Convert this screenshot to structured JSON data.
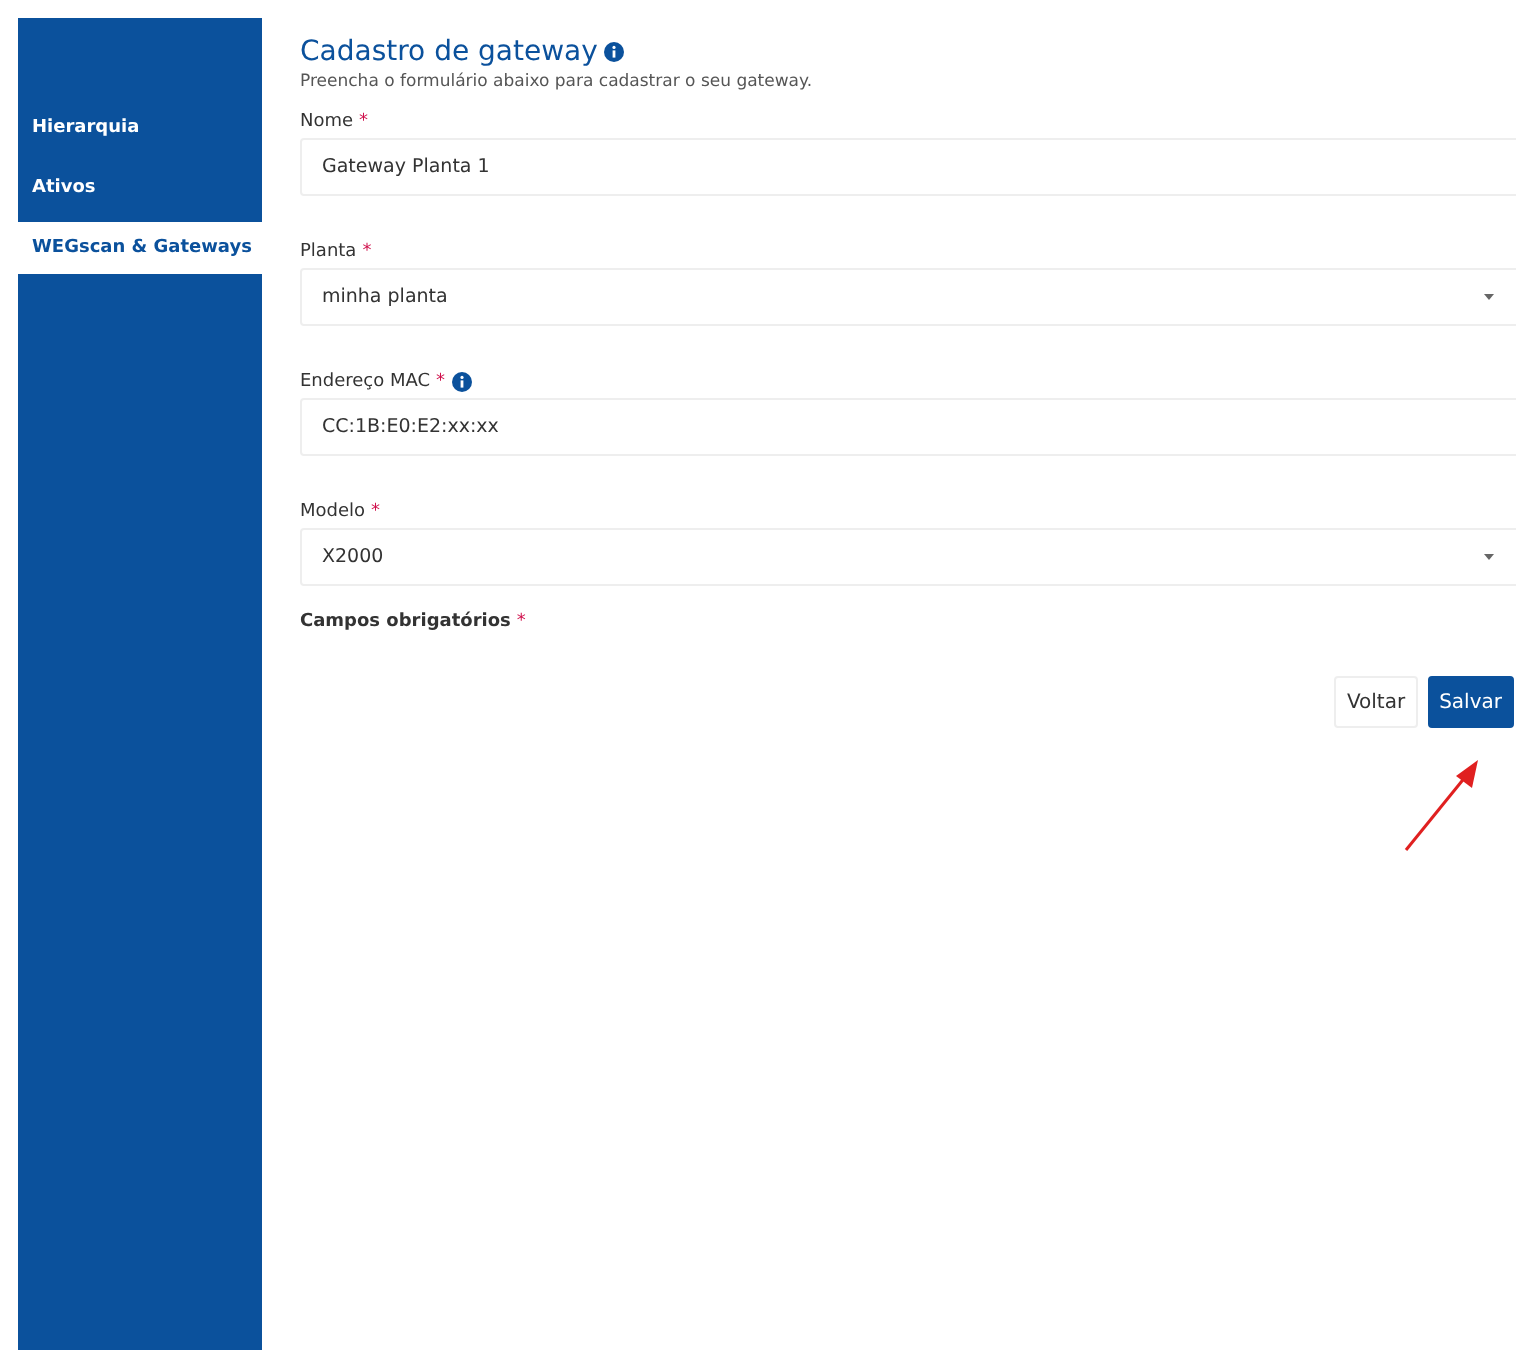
{
  "sidebar": {
    "items": [
      {
        "label": "Hierarquia",
        "selected": false
      },
      {
        "label": "Ativos",
        "selected": false
      },
      {
        "label": "WEGscan & Gateways",
        "selected": true
      }
    ]
  },
  "form": {
    "title": "Cadastro de gateway",
    "subtitle": "Preencha o formulário abaixo para cadastrar o seu gateway.",
    "fields": [
      {
        "label": "Nome",
        "kind": "text",
        "value": "Gateway Planta 1",
        "info": false
      },
      {
        "label": "Planta",
        "kind": "select",
        "value": "minha planta",
        "info": false
      },
      {
        "label": "Endereço MAC",
        "kind": "text",
        "value": "CC:1B:E0:E2:xx:xx",
        "info": true
      },
      {
        "label": "Modelo",
        "kind": "select",
        "value": "X2000",
        "info": false
      }
    ],
    "required_note": "Campos obrigatórios",
    "required_mark": "*",
    "buttons": [
      {
        "label": "Voltar",
        "kind": "secondary"
      },
      {
        "label": "Salvar",
        "kind": "primary"
      }
    ]
  }
}
